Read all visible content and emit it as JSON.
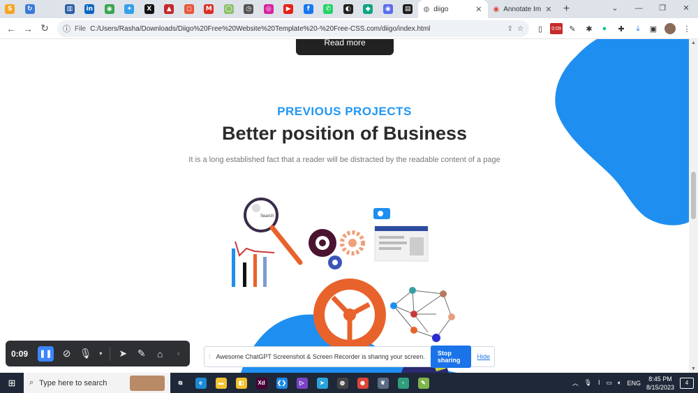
{
  "browser": {
    "pinned_tabs": [
      {
        "icon": "skillshare-icon",
        "glyph": "S",
        "color": "#f5a623"
      },
      {
        "icon": "refresh-app-icon",
        "glyph": "↻",
        "color": "#3b7bd8"
      },
      {
        "icon": "blank-icon",
        "glyph": "",
        "color": "#dee3ea"
      },
      {
        "icon": "building-icon",
        "glyph": "▥",
        "color": "#2d5fa8"
      },
      {
        "icon": "linkedin-icon",
        "glyph": "in",
        "color": "#0a66c2"
      },
      {
        "icon": "green-app-icon",
        "glyph": "◉",
        "color": "#39a651"
      },
      {
        "icon": "bird-icon",
        "glyph": "✦",
        "color": "#35a0ea"
      },
      {
        "icon": "x-icon",
        "glyph": "X",
        "color": "#111111"
      },
      {
        "icon": "spy-icon",
        "glyph": "▲",
        "color": "#c6272b"
      },
      {
        "icon": "chat-bubble-icon",
        "glyph": "◻",
        "color": "#e7563b"
      },
      {
        "icon": "gmail-icon",
        "glyph": "M",
        "color": "#d93025"
      },
      {
        "icon": "circle-app-icon",
        "glyph": "◯",
        "color": "#8ec06c"
      },
      {
        "icon": "speed-icon",
        "glyph": "◷",
        "color": "#555555"
      },
      {
        "icon": "instagram-icon",
        "glyph": "◎",
        "color": "#d6249f"
      },
      {
        "icon": "youtube-icon",
        "glyph": "▶",
        "color": "#e62117"
      },
      {
        "icon": "facebook-icon",
        "glyph": "f",
        "color": "#1877f2"
      },
      {
        "icon": "whatsapp-icon",
        "glyph": "✆",
        "color": "#25d366"
      },
      {
        "icon": "github-icon",
        "glyph": "◐",
        "color": "#222222"
      },
      {
        "icon": "diamond-icon",
        "glyph": "◆",
        "color": "#11a683"
      },
      {
        "icon": "messenger-icon",
        "glyph": "◉",
        "color": "#5b6cf0"
      },
      {
        "icon": "trello-icon",
        "glyph": "▤",
        "color": "#1f1f1f"
      }
    ],
    "tabs": [
      {
        "title": "diigo",
        "close": "✕",
        "active": true
      },
      {
        "title": "Annotate Ima",
        "close": "✕",
        "active": false
      }
    ],
    "new_tab": "+",
    "window_controls": [
      "⌄",
      "—",
      "❐",
      "✕"
    ],
    "address": {
      "info_label": "File",
      "url": "C:/Users/Rasha/Downloads/Diigo%20Free%20Website%20Template%20-%20Free-CSS.com/diigo/index.html"
    },
    "extension_badge": "0:09"
  },
  "page": {
    "read_more": "Read more",
    "eyebrow": "PREVIOUS PROJECTS",
    "headline": "Better position of Business",
    "lead": "It is a long established fact that a reader will be distracted by the readable content of a page",
    "illustration_search_label": "Search",
    "accent_color": "#2196f3"
  },
  "recorder": {
    "time": "0:09"
  },
  "share_banner": {
    "message": "Awesome ChatGPT Screenshot & Screen Recorder is sharing your screen.",
    "stop_label": "Stop sharing",
    "hide_label": "Hide"
  },
  "taskbar": {
    "search_placeholder": "Type here to search",
    "apps": [
      {
        "name": "task-view",
        "glyph": "⧉",
        "color": "#1f2838"
      },
      {
        "name": "edge",
        "glyph": "e",
        "color": "#1b8ad3"
      },
      {
        "name": "file-explorer",
        "glyph": "▬",
        "color": "#f2c233"
      },
      {
        "name": "sticky-app",
        "glyph": "◧",
        "color": "#f0c22b"
      },
      {
        "name": "adobe-xd",
        "glyph": "Xd",
        "color": "#470137"
      },
      {
        "name": "vscode",
        "glyph": "❮❯",
        "color": "#1e88e5"
      },
      {
        "name": "visual-studio",
        "glyph": "▷",
        "color": "#7b43c7"
      },
      {
        "name": "telegram",
        "glyph": "➤",
        "color": "#2aa3dd"
      },
      {
        "name": "obs",
        "glyph": "◍",
        "color": "#444444"
      },
      {
        "name": "chrome",
        "glyph": "◉",
        "color": "#db4437"
      },
      {
        "name": "bird-app",
        "glyph": "❦",
        "color": "#5d6c85"
      },
      {
        "name": "tree-app",
        "glyph": "♆",
        "color": "#2e9e7b"
      },
      {
        "name": "notepad",
        "glyph": "✎",
        "color": "#7fb54a"
      }
    ],
    "language": "ENG",
    "time": "8:45 PM",
    "date": "8/15/2023",
    "notifications": "4"
  }
}
